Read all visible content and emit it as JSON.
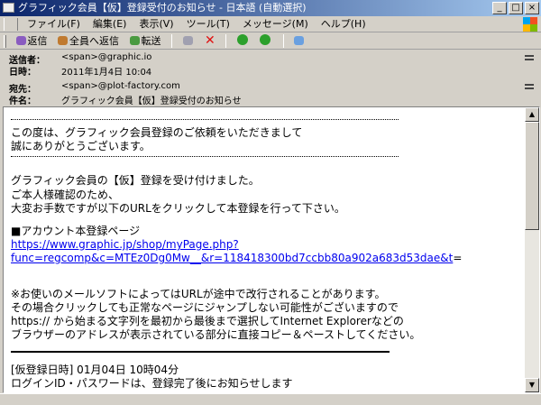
{
  "window": {
    "title": "グラフィック会員【仮】登録受付のお知らせ - 日本語 (自動選択)",
    "min": "_",
    "max": "□",
    "close": "×"
  },
  "menu": [
    "ファイル(F)",
    "編集(E)",
    "表示(V)",
    "ツール(T)",
    "メッセージ(M)",
    "ヘルプ(H)"
  ],
  "toolbar": {
    "reply": "返信",
    "reply_all": "全員へ返信",
    "forward": "転送"
  },
  "headers": [
    {
      "label": "送信者：",
      "value": "<span>@graphic.io"
    },
    {
      "label": "日時：",
      "value": "2011年1月4日 10:04"
    },
    {
      "label": "宛先：",
      "value": "<span>@plot-factory.com"
    },
    {
      "label": "件名：",
      "value": "グラフィック会員【仮】登録受付のお知らせ"
    }
  ],
  "body": {
    "intro": [
      "この度は、グラフィック会員登録のご依頼をいただきまして",
      "誠にありがとうございます。"
    ],
    "accept": [
      "グラフィック会員の【仮】登録を受け付けました。",
      "ご本人様確認のため、",
      "大変お手数ですが以下のURLをクリックして本登録を行って下さい。"
    ],
    "page_label": "■アカウント本登録ページ",
    "url1": "https://www.graphic.jp/shop/myPage.php?",
    "url2": "func=regcomp&c=MTEz0Dg0Mw__&r=118418300bd7ccbb80a902a683d53dae&t",
    "url2_tail": "=",
    "notice": [
      "※お使いのメールソフトによってはURLが途中で改行されることがあります。",
      "その場合クリックしても正常なページにジャンプしない可能性がございますので",
      "https:// から始まる文字列を最初から最後まで選択してInternet Explorerなどの",
      "ブラウザーのアドレスが表示されている部分に直接コピー＆ペーストしてください。"
    ],
    "reg_time": " [仮登録日時] 01月04日  10時04分",
    "login": "ログインID・パスワードは、登録完了後にお知らせします"
  }
}
